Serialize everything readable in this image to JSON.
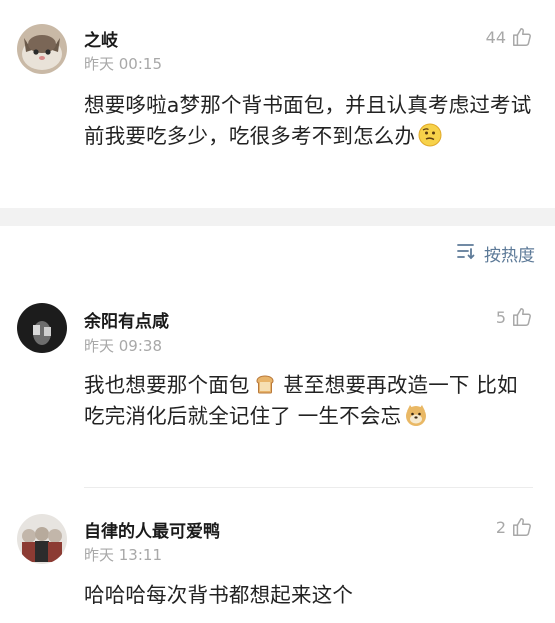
{
  "comments": [
    {
      "username": "之岐",
      "time": "昨天 00:15",
      "likes": "44",
      "text": "想要哆啦a梦那个背书面包，并且认真考虑过考试前我要吃多少，吃很多考不到怎么办",
      "emoji": "thinking-face-emoji"
    },
    {
      "username": "余阳有点咸",
      "time": "昨天 09:38",
      "likes": "5",
      "text_part1": "我也想要那个面包",
      "inline_emoji": "bread-emoji",
      "text_part2": " 甚至想要再改造一下 比如吃完消化后就全记住了 一生不会忘",
      "emoji": "doge-emoji"
    },
    {
      "username": "自律的人最可爱鸭",
      "time": "昨天 13:11",
      "likes": "2",
      "text": "哈哈哈每次背书都想起来这个"
    }
  ],
  "sort": {
    "label": "按热度",
    "icon": "sort-icon"
  },
  "colors": {
    "username": "#1a1a1a",
    "meta": "#a8a8a8",
    "link": "#5d7a98",
    "divider": "#f2f2f2"
  }
}
